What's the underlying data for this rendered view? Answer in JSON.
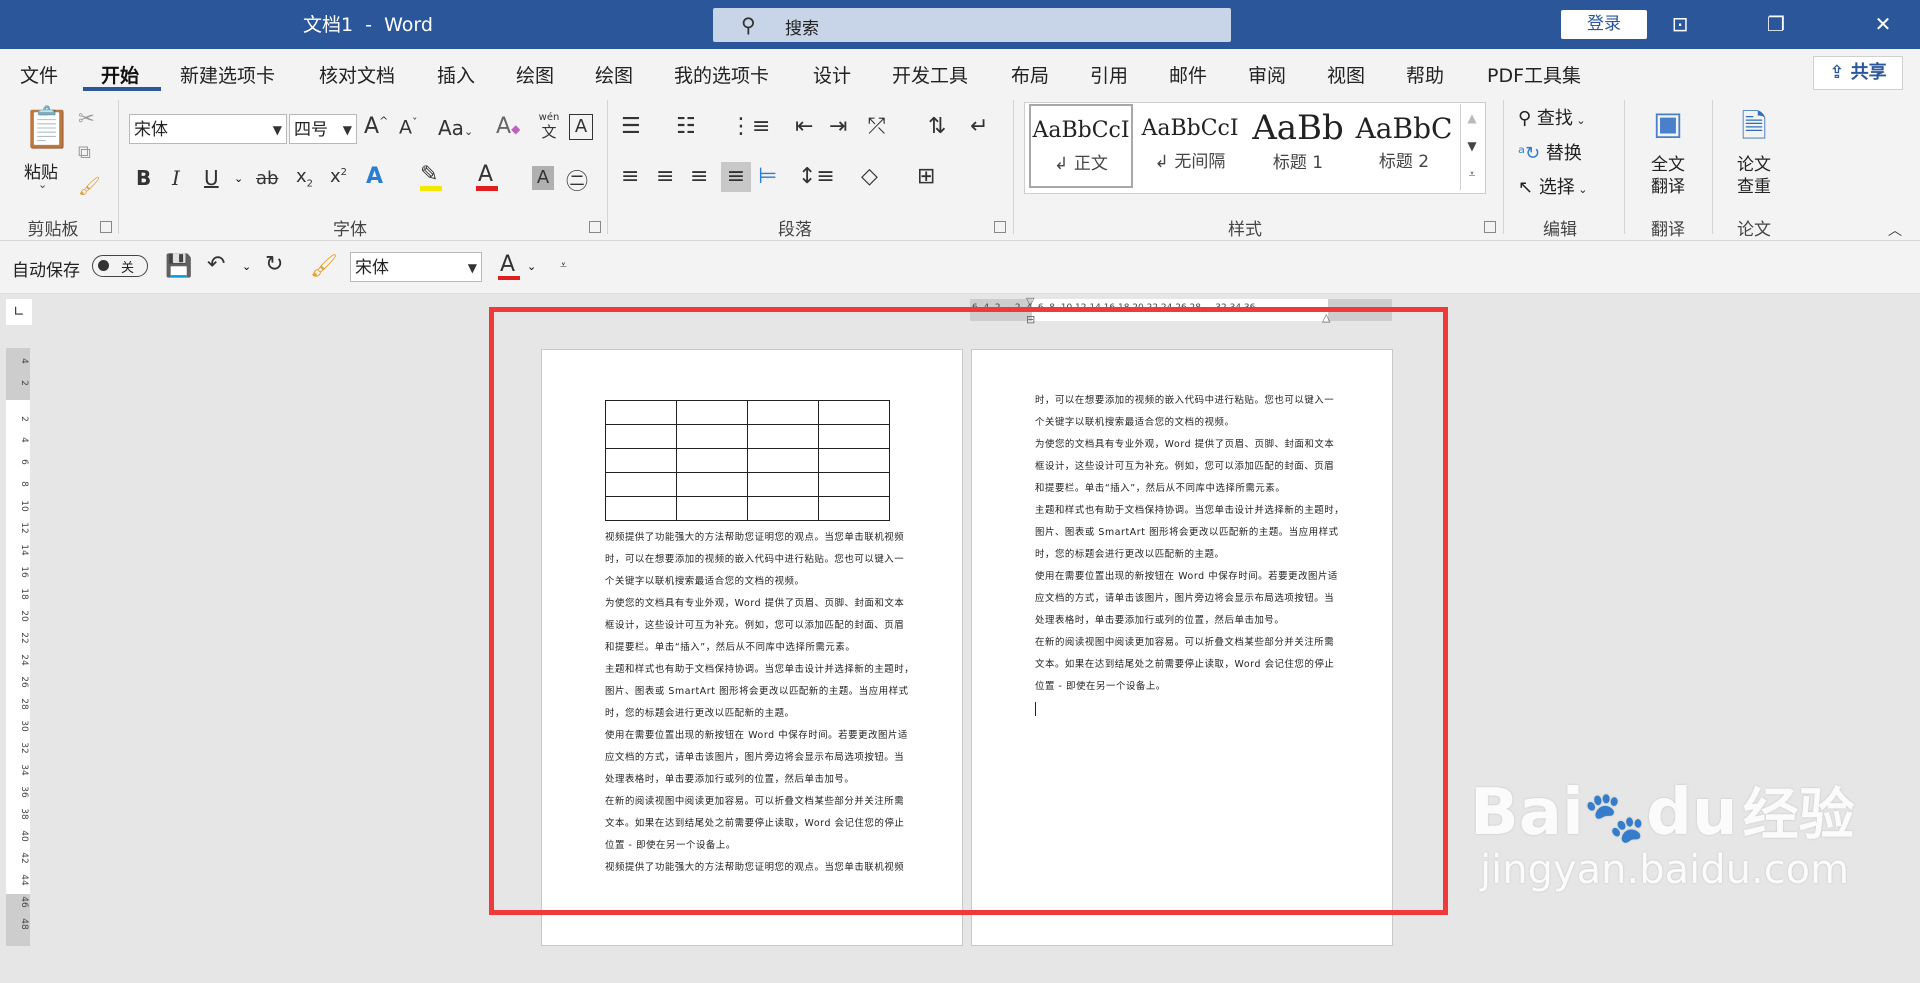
{
  "window": {
    "title": "文档1  -  Word",
    "search_placeholder": "搜索",
    "login": "登录"
  },
  "tabs": [
    "文件",
    "开始",
    "新建选项卡",
    "核对文档",
    "插入",
    "绘图",
    "绘图",
    "我的选项卡",
    "设计",
    "开发工具",
    "布局",
    "引用",
    "邮件",
    "审阅",
    "视图",
    "帮助",
    "PDF工具集"
  ],
  "share": "共享",
  "clipboard": {
    "paste": "粘贴",
    "label": "剪贴板"
  },
  "font": {
    "name": "宋体",
    "size": "四号",
    "label": "字体",
    "case": "Aa",
    "pinyin": "wén",
    "pinyin_char": "文"
  },
  "paragraph": {
    "label": "段落"
  },
  "styles": {
    "items": [
      {
        "preview": "AaBbCcI",
        "name": "正文"
      },
      {
        "preview": "AaBbCcI",
        "name": "无间隔"
      },
      {
        "preview": "AaBb",
        "name": "标题 1"
      },
      {
        "preview": "AaBbC",
        "name": "标题 2"
      }
    ],
    "label": "样式"
  },
  "editing": {
    "find": "查找",
    "replace": "替换",
    "select": "选择",
    "label": "编辑"
  },
  "translate": {
    "button_line1": "全文",
    "button_line2": "翻译",
    "label": "翻译"
  },
  "paper": {
    "button_line1": "论文",
    "button_line2": "查重",
    "label": "论文"
  },
  "qat": {
    "autosave": "自动保存",
    "toggle": "关",
    "font": "宋体"
  },
  "ruler_v": [
    "4",
    "2",
    "2",
    "4",
    "6",
    "8",
    "10",
    "12",
    "14",
    "16",
    "18",
    "20",
    "22",
    "24",
    "26",
    "28",
    "30",
    "32",
    "34",
    "36",
    "38",
    "40",
    "42",
    "44",
    "46",
    "48"
  ],
  "ruler_h": "6  4  2     2  4  6  8  10 12 14 16 18 20 22 24 26 28     32 34 36",
  "page1_lines": [
    "视频提供了功能强大的方法帮助您证明您的观点。当您单击联机视频",
    "时，可以在想要添加的视频的嵌入代码中进行粘贴。您也可以键入一",
    "个关键字以联机搜索最适合您的文档的视频。",
    "为使您的文档具有专业外观，Word 提供了页眉、页脚、封面和文本",
    "框设计，这些设计可互为补充。例如，您可以添加匹配的封面、页眉",
    "和提要栏。单击“插入”，然后从不同库中选择所需元素。",
    "主题和样式也有助于文档保持协调。当您单击设计并选择新的主题时，",
    "图片、图表或 SmartArt 图形将会更改以匹配新的主题。当应用样式",
    "时，您的标题会进行更改以匹配新的主题。",
    "使用在需要位置出现的新按钮在 Word 中保存时间。若要更改图片适",
    "应文档的方式，请单击该图片，图片旁边将会显示布局选项按钮。当",
    "处理表格时，单击要添加行或列的位置，然后单击加号。",
    "在新的阅读视图中阅读更加容易。可以折叠文档某些部分并关注所需",
    "文本。如果在达到结尾处之前需要停止读取，Word 会记住您的停止",
    "位置 - 即使在另一个设备上。",
    "视频提供了功能强大的方法帮助您证明您的观点。当您单击联机视频"
  ],
  "page2_lines": [
    "时，可以在想要添加的视频的嵌入代码中进行粘贴。您也可以键入一",
    "个关键字以联机搜索最适合您的文档的视频。",
    "为使您的文档具有专业外观，Word 提供了页眉、页脚、封面和文本",
    "框设计，这些设计可互为补充。例如，您可以添加匹配的封面、页眉",
    "和提要栏。单击“插入”，然后从不同库中选择所需元素。",
    "主题和样式也有助于文档保持协调。当您单击设计并选择新的主题时，",
    "图片、图表或 SmartArt 图形将会更改以匹配新的主题。当应用样式",
    "时，您的标题会进行更改以匹配新的主题。",
    "使用在需要位置出现的新按钮在 Word 中保存时间。若要更改图片适",
    "应文档的方式，请单击该图片，图片旁边将会显示布局选项按钮。当",
    "处理表格时，单击要添加行或列的位置，然后单击加号。",
    "在新的阅读视图中阅读更加容易。可以折叠文档某些部分并关注所需",
    "文本。如果在达到结尾处之前需要停止读取，Word 会记住您的停止",
    "位置 - 即使在另一个设备上。"
  ],
  "watermark": {
    "brand": "Bai",
    "brand2": "du",
    "cn": "经验",
    "url": "jingyan.baidu.com"
  },
  "colors": {
    "titlebar": "#2b579a",
    "highlight_red": "#f03a3a"
  }
}
